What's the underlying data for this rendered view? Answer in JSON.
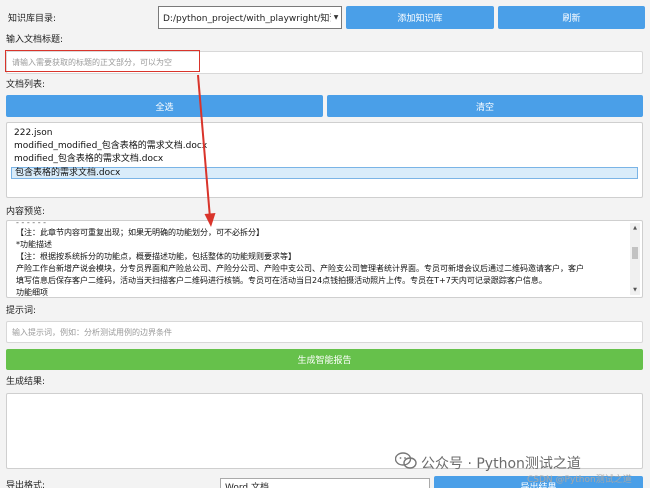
{
  "kb": {
    "dir_label": "知识库目录:",
    "dir_value": "D:/python_project/with_playwright/知识库",
    "add_button": "添加知识库",
    "refresh_button": "刷新"
  },
  "title_input": {
    "label": "输入文档标题:",
    "placeholder": "请输入需要获取的标题的正文部分，可以为空"
  },
  "doc_list": {
    "label": "文档列表:",
    "select_all": "全选",
    "clear": "清空",
    "items": [
      "222.json",
      "modified_modified_包含表格的需求文档.docx",
      "modified_包含表格的需求文档.docx",
      "包含表格的需求文档.docx"
    ],
    "selected_index": 3
  },
  "preview": {
    "label": "内容预览:",
    "lines": [
      "【注：此章节内容可重复出现；如果无明确的功能划分，可不必拆分】",
      "*功能描述",
      "【注：根据按系统拆分的功能点，概要描述功能，包括整体的功能规则要求等】",
      "产险工作台新增产说会模块，分专员界面和产险总公司、产险分公司、产险中支公司、产险支公司管理者统计界面。专员可新增会议后通过二维码邀请客户，客户",
      "填写信息后保存客户二维码，活动当天扫描客户二维码进行核销。专员可在活动当日24点钱拍摄活动照片上传。专员在T+7天内可记录跟踪客户信息。",
      "功能细项"
    ]
  },
  "prompt": {
    "label": "提示词:",
    "placeholder": "输入提示词，例如：分析测试用例的边界条件"
  },
  "generate_button": "生成智能报告",
  "result": {
    "label": "生成结果:"
  },
  "export": {
    "label": "导出格式:",
    "format_value": "Word 文档",
    "export_button": "导出结果"
  },
  "watermark": {
    "main": "公众号 · Python测试之道",
    "sub": "CSDN @Python测试之道"
  },
  "annotation_color": "#d9342b",
  "colors": {
    "button_blue": "#4a9fe8",
    "button_green": "#66c14b",
    "selection_bg": "#d9ecfa"
  }
}
